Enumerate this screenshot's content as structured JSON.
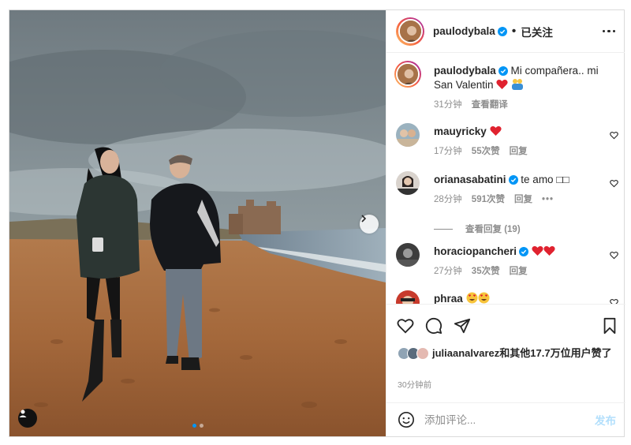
{
  "post": {
    "author": "paulodybala",
    "follow_separator": "•",
    "follow_status": "已关注",
    "caption": "Mi compañera.. mi San Valentin",
    "caption_time": "31分钟",
    "caption_translate": "查看翻译",
    "likes_text": "juliaanalvarez和其他17.7万位用户赞了",
    "liked_by_user": "juliaanalvarez",
    "timestamp": "30分钟前",
    "carousel": {
      "current": 1,
      "total": 2
    }
  },
  "comments": [
    {
      "user": "mauyricky",
      "text": "",
      "emoji": "red-heart",
      "time": "17分钟",
      "likes": "55次赞",
      "reply": "回复"
    },
    {
      "user": "orianasabatini",
      "verified": true,
      "text": "te amo □□",
      "time": "28分钟",
      "likes": "591次赞",
      "reply": "回复",
      "more": "•••",
      "view_replies": "查看回复 (19)"
    },
    {
      "user": "horaciopancheri",
      "verified": true,
      "text": "",
      "emoji": "two-red-hearts",
      "time": "27分钟",
      "likes": "35次赞",
      "reply": "回复"
    },
    {
      "user": "phraa",
      "text": "",
      "emoji": "heart-eyes x2"
    }
  ],
  "composer": {
    "placeholder": "添加评论...",
    "post_label": "发布"
  },
  "colors": {
    "accent": "#0095f6",
    "text": "#262626",
    "muted": "#8e8e8e",
    "post_disabled": "#b2dffc",
    "heart": "#ed4956"
  },
  "icons": [
    "verified-icon",
    "more-icon",
    "heart-icon",
    "comment-icon",
    "share-icon",
    "bookmark-icon",
    "emoji-icon",
    "user-tag-icon",
    "chevron-right-icon"
  ]
}
